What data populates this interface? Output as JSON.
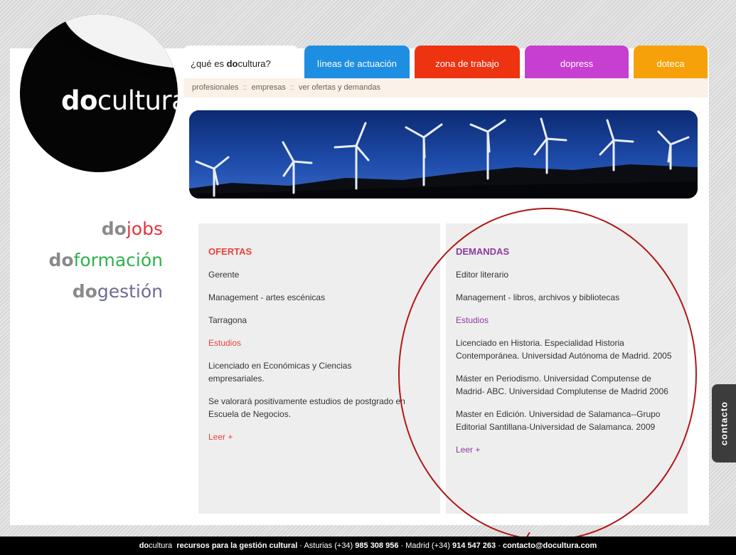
{
  "logo": {
    "bold": "do",
    "rest": "cultura"
  },
  "tabs": [
    {
      "pre": "¿qué es ",
      "bold": "do",
      "post": "cultura?",
      "color": "#ffffff",
      "active": true
    },
    {
      "label": "líneas de actuación",
      "color": "#1e8ee3"
    },
    {
      "label": "zona de trabajo",
      "color": "#ee3311"
    },
    {
      "label": "dopress",
      "color": "#c63fd0"
    },
    {
      "label": "doteca",
      "color": "#f6a10a"
    }
  ],
  "subnav": {
    "items": [
      "profesionales",
      "empresas",
      "ver ofertas y demandas"
    ],
    "separator": "::"
  },
  "sidemenu": [
    {
      "prefix": "do",
      "word": "jobs",
      "color": "#e2343b"
    },
    {
      "prefix": "do",
      "word": "formación",
      "color": "#2eb24b"
    },
    {
      "prefix": "do",
      "word": "gestión",
      "color": "#6d6b96"
    }
  ],
  "ofertas": {
    "title": "OFERTAS",
    "color": "#e8433d",
    "lines": [
      "Gerente",
      "Management - artes escénicas",
      "Tarragona"
    ],
    "category": "Estudios",
    "details": [
      "Licenciado en Económicas y Ciencias empresariales.",
      "Se valorará positivamente estudios de postgrado en Escuela de Negocios."
    ],
    "more": "Leer +"
  },
  "demandas": {
    "title": "DEMANDAS",
    "color": "#8b3a9e",
    "lines": [
      "Editor literario",
      "Management - libros, archivos y bibliotecas"
    ],
    "category": "Estudios",
    "details": [
      "Licenciado en Historia. Especialidad Historia Contemporánea. Universidad Autónoma de Madrid. 2005",
      "Máster en Periodismo. Universidad Computense de Madrid- ABC. Universidad Complutense de Madrid 2006",
      "Master en Edición. Universidad de Salamanca--Grupo Editorial Santillana-Universidad de Salamanca. 2009"
    ],
    "more": "Leer +"
  },
  "contact_tab": "contacto",
  "footer": {
    "brand_bold": "do",
    "brand_rest": "cultura",
    "tagline": "recursos para la gestión cultural",
    "asturias_label": "Asturias (+34)",
    "asturias_phone": "985 308 956",
    "madrid_label": "Madrid (+34)",
    "madrid_phone": "914 547 263",
    "email": "contacto@docultura.com",
    "sep": "·"
  },
  "colors": {
    "annotation_circle": "#b01717",
    "footer_bg": "#000000"
  }
}
